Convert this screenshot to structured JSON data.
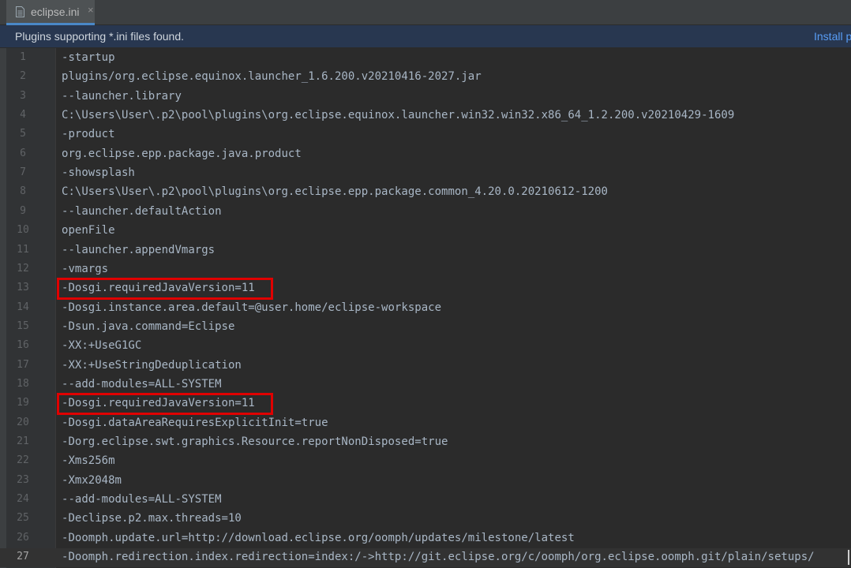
{
  "tab": {
    "label": "eclipse.ini",
    "icon": "file-icon",
    "close_glyph": "×"
  },
  "banner": {
    "message": "Plugins supporting *.ini files found.",
    "action_label": "Install p"
  },
  "editor": {
    "current_line": 27,
    "highlighted_lines": [
      13,
      19
    ],
    "lines": [
      {
        "number": "1",
        "text": "-startup"
      },
      {
        "number": "2",
        "text": "plugins/org.eclipse.equinox.launcher_1.6.200.v20210416-2027.jar"
      },
      {
        "number": "3",
        "text": "--launcher.library"
      },
      {
        "number": "4",
        "text": "C:\\Users\\User\\.p2\\pool\\plugins\\org.eclipse.equinox.launcher.win32.win32.x86_64_1.2.200.v20210429-1609"
      },
      {
        "number": "5",
        "text": "-product"
      },
      {
        "number": "6",
        "text": "org.eclipse.epp.package.java.product"
      },
      {
        "number": "7",
        "text": "-showsplash"
      },
      {
        "number": "8",
        "text": "C:\\Users\\User\\.p2\\pool\\plugins\\org.eclipse.epp.package.common_4.20.0.20210612-1200"
      },
      {
        "number": "9",
        "text": "--launcher.defaultAction"
      },
      {
        "number": "10",
        "text": "openFile"
      },
      {
        "number": "11",
        "text": "--launcher.appendVmargs"
      },
      {
        "number": "12",
        "text": "-vmargs"
      },
      {
        "number": "13",
        "text": "-Dosgi.requiredJavaVersion=11"
      },
      {
        "number": "14",
        "text": "-Dosgi.instance.area.default=@user.home/eclipse-workspace"
      },
      {
        "number": "15",
        "text": "-Dsun.java.command=Eclipse"
      },
      {
        "number": "16",
        "text": "-XX:+UseG1GC"
      },
      {
        "number": "17",
        "text": "-XX:+UseStringDeduplication"
      },
      {
        "number": "18",
        "text": "--add-modules=ALL-SYSTEM"
      },
      {
        "number": "19",
        "text": "-Dosgi.requiredJavaVersion=11"
      },
      {
        "number": "20",
        "text": "-Dosgi.dataAreaRequiresExplicitInit=true"
      },
      {
        "number": "21",
        "text": "-Dorg.eclipse.swt.graphics.Resource.reportNonDisposed=true"
      },
      {
        "number": "22",
        "text": "-Xms256m"
      },
      {
        "number": "23",
        "text": "-Xmx2048m"
      },
      {
        "number": "24",
        "text": "--add-modules=ALL-SYSTEM"
      },
      {
        "number": "25",
        "text": "-Declipse.p2.max.threads=10"
      },
      {
        "number": "26",
        "text": "-Doomph.update.url=http://download.eclipse.org/oomph/updates/milestone/latest"
      },
      {
        "number": "27",
        "text": "-Doomph.redirection.index.redirection=index:/->http://git.eclipse.org/c/oomph/org.eclipse.oomph.git/plain/setups/"
      }
    ]
  },
  "colors": {
    "background": "#2b2b2b",
    "gutter": "#313335",
    "text": "#a9b7c6",
    "line_number": "#606366",
    "banner_bg": "#283750",
    "link": "#589df6",
    "highlight_border": "#e00000",
    "tab_underline": "#4a88c7"
  }
}
